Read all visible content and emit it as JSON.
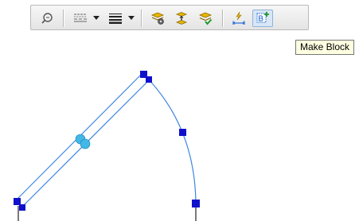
{
  "tooltip": {
    "text": "Make Block"
  },
  "toolbar": {
    "buttons": [
      {
        "icon": "zoom-icon"
      },
      {
        "icon": "line-style-icon"
      },
      {
        "icon": "dropdown-arrow-icon"
      },
      {
        "icon": "line-weight-icon"
      },
      {
        "icon": "dropdown-arrow-icon"
      },
      {
        "icon": "layer-settings-icon"
      },
      {
        "icon": "layer-transfer-icon"
      },
      {
        "icon": "layer-check-icon"
      },
      {
        "icon": "quick-measure-icon"
      },
      {
        "icon": "make-block-icon"
      }
    ]
  },
  "colors": {
    "selection_line": "#4a90e2",
    "grip": "#1010cc",
    "midpoint_grip": "#42b8e6",
    "toolbar_accent": "#d2a000"
  }
}
